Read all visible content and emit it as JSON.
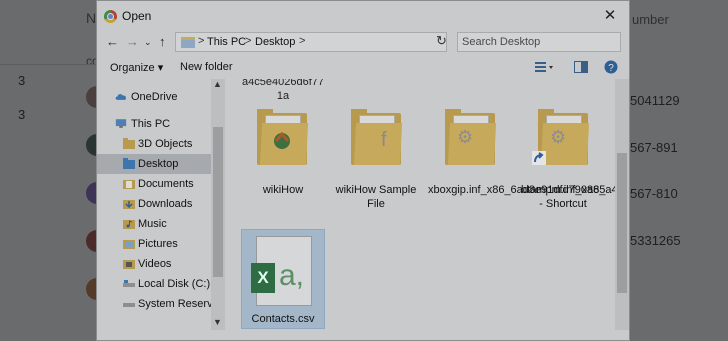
{
  "background": {
    "header_left": "N",
    "header_right": "umber",
    "subheader_left": "co",
    "left_counts": [
      "3",
      "3"
    ],
    "right_numbers": [
      "5041129",
      "567-891",
      "567-810",
      "5331265"
    ]
  },
  "dialog": {
    "title": "Open",
    "close_label": "✕",
    "address": {
      "crumbs": [
        "This PC",
        "Desktop"
      ],
      "separators": [
        ">",
        ">",
        ">"
      ]
    },
    "search_placeholder": "Search Desktop",
    "toolbar": {
      "organize_label": "Organize ▾",
      "new_folder_label": "New folder"
    },
    "nav_items": [
      {
        "label": "OneDrive",
        "icon": "cloud-icon"
      },
      {
        "label": "This PC",
        "icon": "computer-icon"
      },
      {
        "label": "3D Objects",
        "icon": "folder-icon"
      },
      {
        "label": "Desktop",
        "icon": "folder-icon",
        "selected": true
      },
      {
        "label": "Documents",
        "icon": "documents-icon"
      },
      {
        "label": "Downloads",
        "icon": "downloads-icon"
      },
      {
        "label": "Music",
        "icon": "music-icon"
      },
      {
        "label": "Pictures",
        "icon": "pictures-icon"
      },
      {
        "label": "Videos",
        "icon": "videos-icon"
      },
      {
        "label": "Local Disk (C:)",
        "icon": "disk-icon"
      },
      {
        "label": "System Reserved",
        "icon": "disk-icon"
      }
    ],
    "files": [
      {
        "name": "a4c5e4026d6f77 1a"
      },
      {
        "name": "wikiHow"
      },
      {
        "name": "wikiHow Sample File"
      },
      {
        "name": "xboxgip.inf_x86_6ad8e91dfd790a85"
      },
      {
        "name": "btampm.inf_x86_a4c5e4026d6f771a - Shortcut"
      },
      {
        "name": "Contacts.csv",
        "selected": true
      }
    ]
  }
}
